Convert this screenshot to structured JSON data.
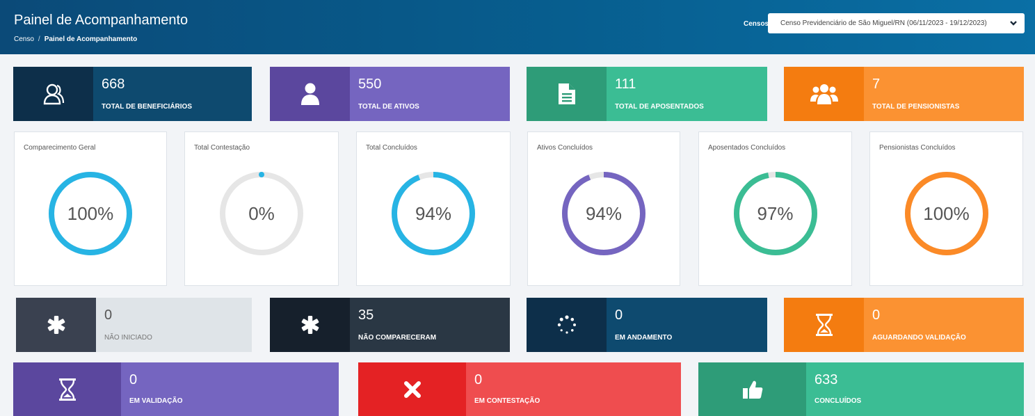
{
  "header": {
    "title": "Painel de Acompanhamento",
    "breadcrumb": [
      "Censo",
      "Painel de Acompanhamento"
    ],
    "censos_label": "Censos",
    "censos_selected": "Censo Previdenciário de São Miguel/RN (06/11/2023 - 19/12/2023)"
  },
  "top_cards": [
    {
      "value": "668",
      "label": "TOTAL DE BENEFICIÁRIOS",
      "icon": "users-outline-icon",
      "icon_bg": "#0d2f4a",
      "bg": "#0e4a6f"
    },
    {
      "value": "550",
      "label": "TOTAL DE ATIVOS",
      "icon": "user-icon",
      "icon_bg": "#5b479e",
      "bg": "#7565c0"
    },
    {
      "value": "111",
      "label": "TOTAL DE APOSENTADOS",
      "icon": "document-icon",
      "icon_bg": "#2e9c78",
      "bg": "#3bbd94"
    },
    {
      "value": "7",
      "label": "TOTAL DE PENSIONISTAS",
      "icon": "group-icon",
      "icon_bg": "#f47c10",
      "bg": "#fb9232"
    }
  ],
  "gauges": [
    {
      "title": "Comparecimento Geral",
      "value": "100%",
      "fraction": 1.0,
      "color": "#27b4e4"
    },
    {
      "title": "Total Contestação",
      "value": "0%",
      "fraction": 0.0,
      "color": "#27b4e4"
    },
    {
      "title": "Total Concluídos",
      "value": "94%",
      "fraction": 0.94,
      "color": "#27b4e4"
    },
    {
      "title": "Ativos Concluídos",
      "value": "94%",
      "fraction": 0.94,
      "color": "#7565c0"
    },
    {
      "title": "Aposentados Concluídos",
      "value": "97%",
      "fraction": 0.97,
      "color": "#3bbd94"
    },
    {
      "title": "Pensionistas Concluídos",
      "value": "100%",
      "fraction": 1.0,
      "color": "#fb8a27"
    }
  ],
  "status_cards": [
    {
      "value": "0",
      "label": "NÃO INICIADO",
      "icon": "asterisk-icon",
      "icon_bg": "#3a4150",
      "bg": "#dfe4e8",
      "text_color": "#555"
    },
    {
      "value": "35",
      "label": "NÃO COMPARECERAM",
      "icon": "asterisk-icon",
      "icon_bg": "#16202c",
      "bg": "#2a3744",
      "text_color": "#fff"
    },
    {
      "value": "0",
      "label": "EM ANDAMENTO",
      "icon": "spinner-icon",
      "icon_bg": "#0d2f4a",
      "bg": "#0e4a6f",
      "text_color": "#fff"
    },
    {
      "value": "0",
      "label": "AGUARDANDO VALIDAÇÃO",
      "icon": "hourglass-icon",
      "icon_bg": "#f47c10",
      "bg": "#fb9232",
      "text_color": "#fff"
    }
  ],
  "bottom_cards": [
    {
      "value": "0",
      "label": "EM VALIDAÇÃO",
      "icon": "hourglass-icon",
      "icon_bg": "#5b479e",
      "bg": "#7565c0"
    },
    {
      "value": "0",
      "label": "EM CONTESTAÇÃO",
      "icon": "close-icon",
      "icon_bg": "#e42224",
      "bg": "#ef4d4f"
    },
    {
      "value": "633",
      "label": "CONCLUÍDOS",
      "icon": "thumbs-up-icon",
      "icon_bg": "#2e9c78",
      "bg": "#3bbd94"
    }
  ]
}
